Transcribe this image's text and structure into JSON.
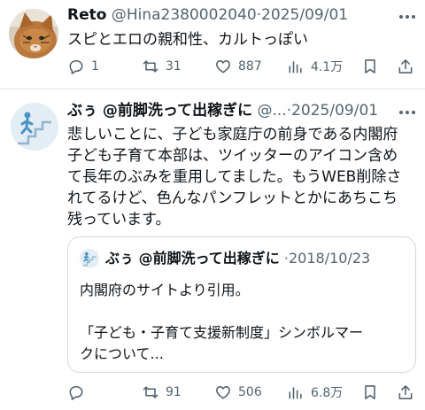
{
  "post1": {
    "name": "Reto",
    "handle": "@Hina2380002040",
    "separator": "·",
    "date": "2025/09/01",
    "text": "スピとエロの親和性、カルトっぽい",
    "actions": {
      "reply_count": "1",
      "retweet_count": "31",
      "like_count": "887",
      "view_count": "4.1万"
    }
  },
  "post2": {
    "name": "ぶぅ @前脚洗って出稼ぎに",
    "handle": "@...",
    "separator": "·",
    "date": "2025/09/01",
    "text": "悲しいことに、子ども家庭庁の前身である内閣府\n子ども子育て本部は、ツイッターのアイコン含め\nて長年のぶみを重用してました。もうWEB削除さ\nれてるけど、色んなパンフレットとかにあちこち\n残っています。",
    "quote": {
      "name": "ぶぅ @前脚洗って出稼ぎに",
      "separator": "·",
      "date": "2018/10/23",
      "text": "内閣府のサイトより引用。\n\n「子ども・子育て支援新制度」シンボルマー\nクについて..."
    },
    "actions": {
      "reply_count": "",
      "retweet_count": "91",
      "like_count": "506",
      "view_count": "6.8万"
    }
  },
  "icons": {
    "reply": "reply-icon",
    "retweet": "retweet-icon",
    "like": "heart-icon",
    "views": "views-icon",
    "bookmark": "bookmark-icon",
    "share": "share-icon",
    "more": "more-icon"
  },
  "colors": {
    "text": "#0f1419",
    "secondary": "#536471",
    "border": "#cfd9de",
    "divider": "#e6e8ea"
  }
}
